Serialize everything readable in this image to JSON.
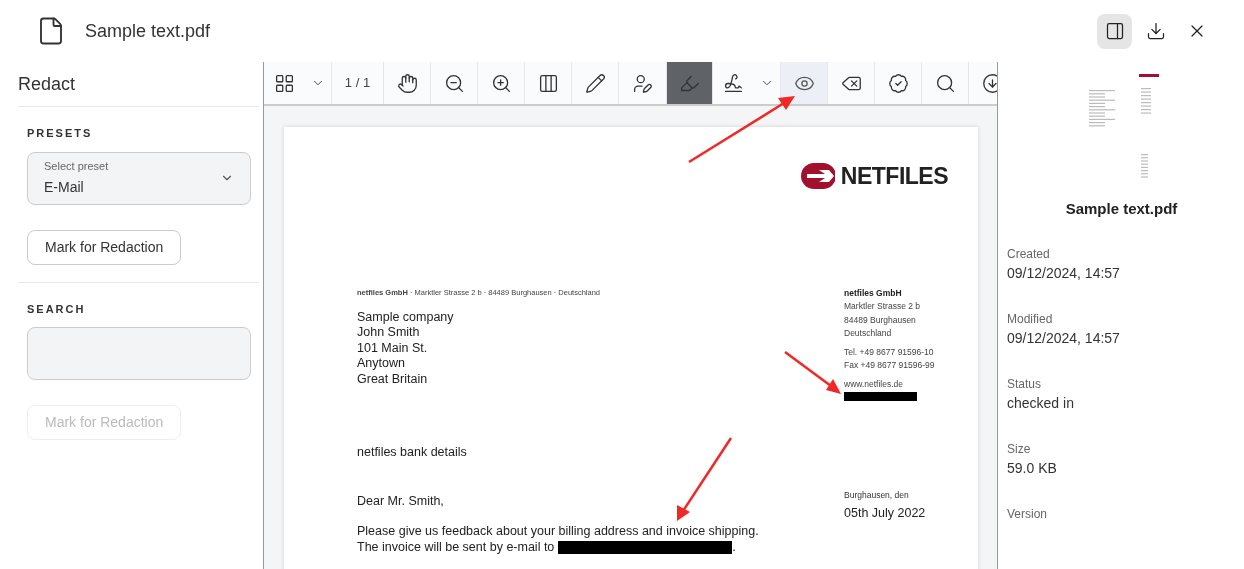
{
  "header": {
    "title": "Sample text.pdf",
    "actions": [
      {
        "kind": "panel",
        "selected": true
      },
      {
        "kind": "download",
        "selected": false
      },
      {
        "kind": "close",
        "selected": false
      }
    ]
  },
  "sidebar": {
    "title": "Redact",
    "presets": {
      "heading": "PRESETS",
      "select": {
        "label": "Select preset",
        "value": "E-Mail"
      },
      "button": {
        "label": "Mark for Redaction",
        "disabled": false
      }
    },
    "search": {
      "heading": "SEARCH",
      "button": {
        "label": "Mark for Redaction",
        "disabled": true
      }
    }
  },
  "toolbar": {
    "tools": [
      {
        "kind": "grid",
        "selected": false,
        "highlighted": false
      },
      {
        "kind": "chevron",
        "selected": false,
        "highlighted": false
      },
      {
        "kind": "page",
        "label": "1 / 1"
      },
      {
        "kind": "hand",
        "selected": false,
        "highlighted": false
      },
      {
        "kind": "zoom-out",
        "selected": false,
        "highlighted": false
      },
      {
        "kind": "zoom-in",
        "selected": false,
        "highlighted": false
      },
      {
        "kind": "columns",
        "selected": false,
        "highlighted": false
      },
      {
        "kind": "pencil",
        "selected": false,
        "highlighted": false
      },
      {
        "kind": "pencil-user",
        "selected": false,
        "highlighted": false
      },
      {
        "kind": "highlighter",
        "selected": true,
        "highlighted": false
      },
      {
        "kind": "signature",
        "selected": false,
        "highlighted": false
      },
      {
        "kind": "chevron",
        "selected": false,
        "highlighted": false
      },
      {
        "kind": "redact-eye",
        "selected": false,
        "highlighted": true
      },
      {
        "kind": "erase",
        "selected": false,
        "highlighted": false
      },
      {
        "kind": "badge",
        "selected": false,
        "highlighted": false
      },
      {
        "kind": "search",
        "selected": false,
        "highlighted": false
      },
      {
        "kind": "download",
        "selected": false,
        "highlighted": false
      }
    ]
  },
  "document": {
    "logo": "NETFILES",
    "sender_line": "**netfiles GmbH** · Marktler Strasse 2 b · 84489 Burghausen · Deutschland",
    "recipient": [
      "Sample company",
      "John Smith",
      "101 Main St.",
      "Anytown",
      "Great Britain"
    ],
    "company": {
      "name": "netfiles GmbH",
      "address": [
        "Marktler Strasse 2 b",
        "84489 Burghausen",
        "Deutschland"
      ],
      "contact": [
        "Tel. +49 8677 91596-10",
        "Fax +49 8677 91596-99"
      ],
      "web": "www.netfiles.de",
      "redacted": true
    },
    "subject": "netfiles bank details",
    "place": "Burghausen, den",
    "date": "05th July 2022",
    "salutation": "Dear Mr. Smith,",
    "body": "Please give us feedback about your billing address and invoice shipping.",
    "email_line": {
      "before": "The invoice will be sent by e-mail to",
      "after": ".",
      "redacted": true
    }
  },
  "details": {
    "file_name": "Sample text.pdf",
    "properties": [
      {
        "label": "Created",
        "value": "09/12/2024, 14:57"
      },
      {
        "label": "Modified",
        "value": "09/12/2024, 14:57"
      },
      {
        "label": "Status",
        "value": "checked in"
      },
      {
        "label": "Size",
        "value": "59.0 KB"
      },
      {
        "label": "Version"
      }
    ]
  }
}
